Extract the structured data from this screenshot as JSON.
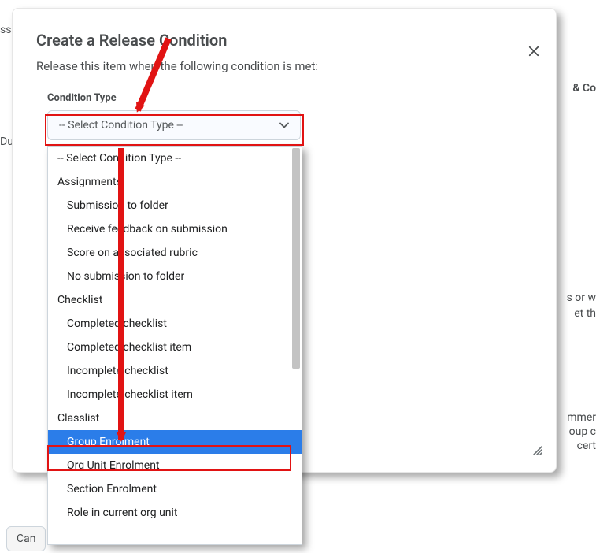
{
  "modal": {
    "title": "Create a Release Condition",
    "subtitle": "Release this item when the following condition is met:",
    "close_icon": "close"
  },
  "field": {
    "label": "Condition Type",
    "selected_text": "-- Select Condition Type --"
  },
  "dropdown": {
    "placeholder": "-- Select Condition Type --",
    "groups": [
      {
        "label": "Assignments",
        "items": [
          "Submission to folder",
          "Receive feedback on submission",
          "Score on associated rubric",
          "No submission to folder"
        ]
      },
      {
        "label": "Checklist",
        "items": [
          "Completed checklist",
          "Completed checklist item",
          "Incomplete checklist",
          "Incomplete checklist item"
        ]
      },
      {
        "label": "Classlist",
        "items": [
          "Group Enrolment",
          "Org Unit Enrolment",
          "Section Enrolment",
          "Role in current org unit"
        ]
      }
    ],
    "highlighted": "Group Enrolment"
  },
  "background": {
    "assign_fragment": "ssi",
    "due_fragment": "Du",
    "c_fragment": "C",
    "cond_fragment": "& Co",
    "line1_fragment": "s or w",
    "line2_fragment": "et th",
    "line3_fragment": "mmer",
    "line4_fragment": "oup c",
    "line5_fragment": "cert",
    "cancel_label": "Can"
  }
}
